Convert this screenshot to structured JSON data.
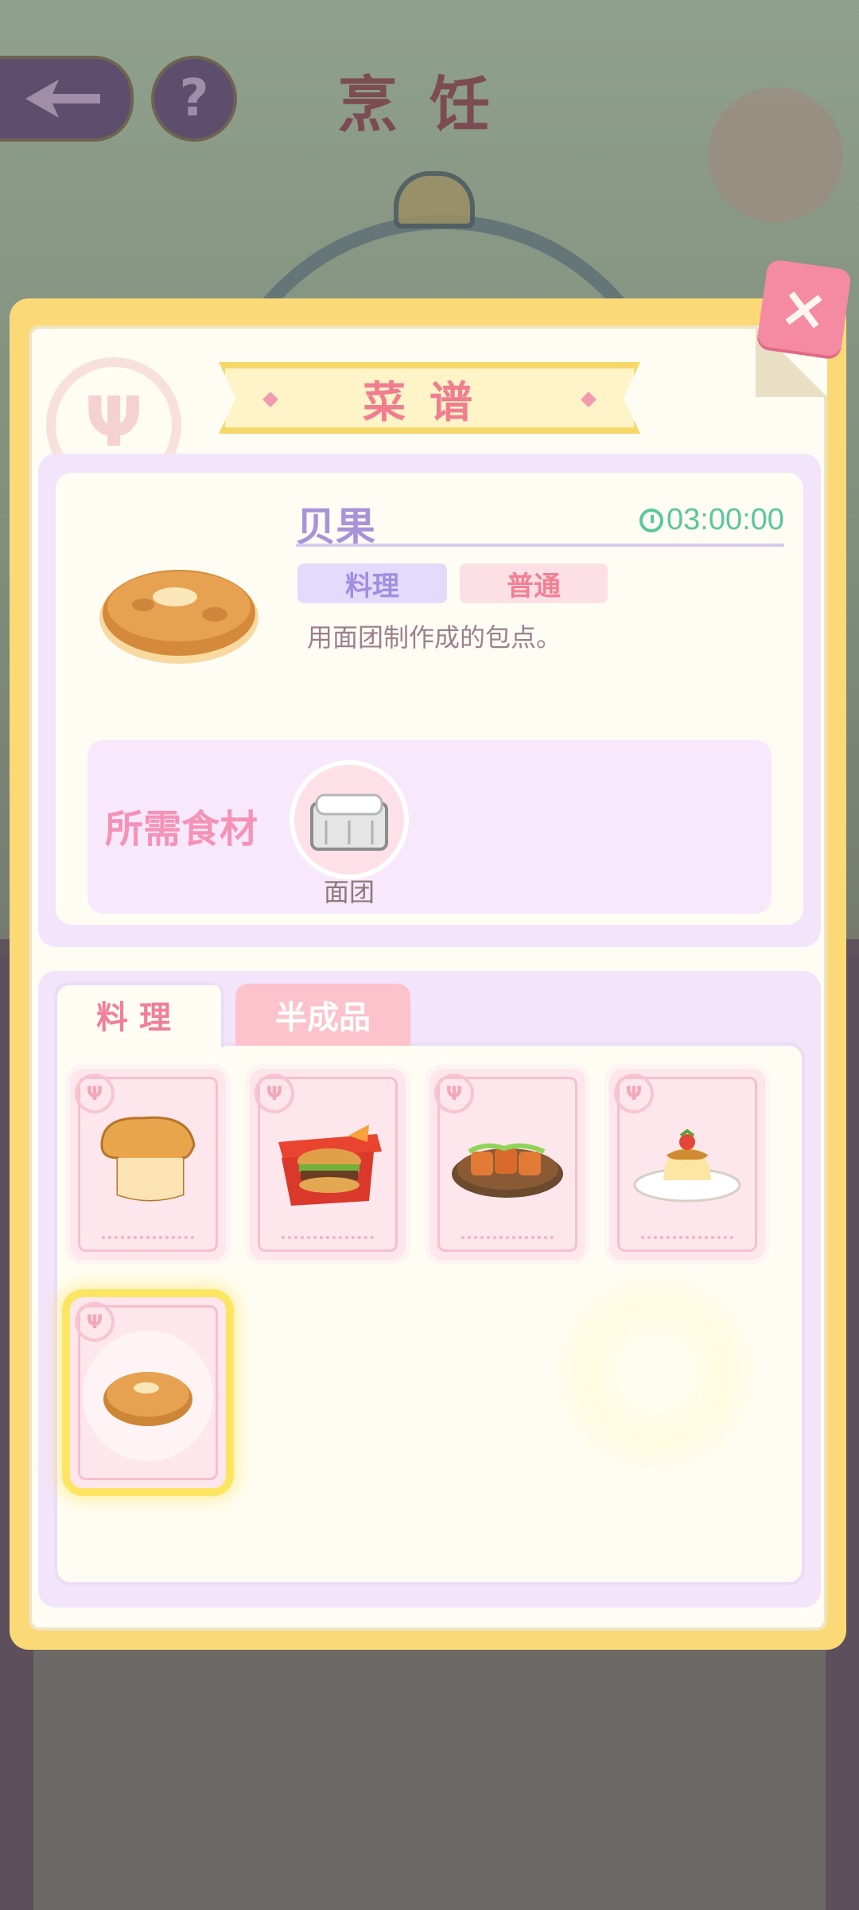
{
  "screen": {
    "title": "烹饪",
    "back_icon": "back-arrow-icon",
    "help_label": "?"
  },
  "recipe_book": {
    "title": "菜谱",
    "close_label": "×",
    "selected": {
      "name": "贝果",
      "time": "03:00:00",
      "tags": [
        "料理",
        "普通"
      ],
      "description": "用面团制作成的包点。",
      "ingredients_label": "所需食材",
      "ingredients": [
        {
          "name": "面团",
          "icon": "dough-box-icon"
        }
      ]
    },
    "tabs": [
      {
        "label": "料理",
        "active": true
      },
      {
        "label": "半成品",
        "active": false
      }
    ],
    "recipes": [
      {
        "icon": "bread-loaf-icon",
        "selected": false
      },
      {
        "icon": "burger-box-icon",
        "selected": false
      },
      {
        "icon": "grilled-meat-plate-icon",
        "selected": false
      },
      {
        "icon": "pudding-icon",
        "selected": false
      },
      {
        "icon": "bagel-icon",
        "selected": true
      }
    ]
  },
  "colors": {
    "accent_pink": "#f07e90",
    "accent_purple": "#a993d8",
    "timer_green": "#5ac69e",
    "frame_yellow": "#fbd977"
  }
}
